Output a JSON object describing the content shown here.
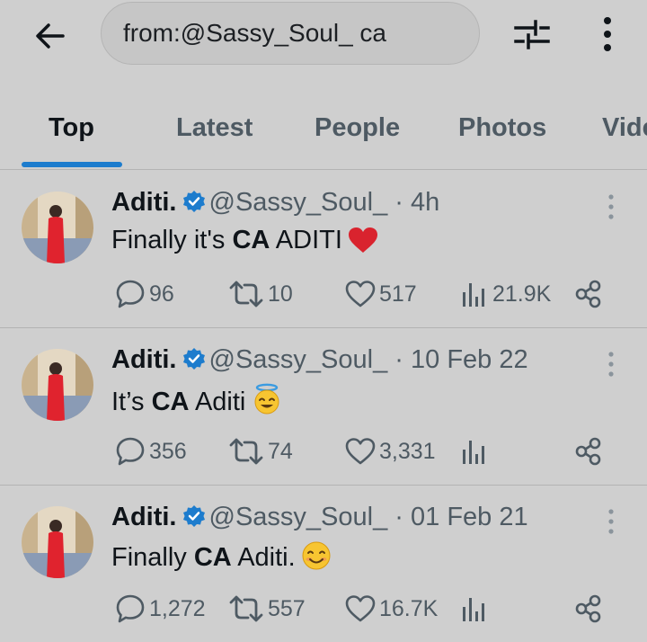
{
  "search": {
    "query": "from:@Sassy_Soul_ ca"
  },
  "tabs": [
    {
      "label": "Top",
      "active": true
    },
    {
      "label": "Latest",
      "active": false
    },
    {
      "label": "People",
      "active": false
    },
    {
      "label": "Photos",
      "active": false
    },
    {
      "label": "Videos",
      "active": false
    }
  ],
  "tweets": [
    {
      "name": "Aditi.",
      "handle": "@Sassy_Soul_",
      "dot": "·",
      "time": "4h",
      "text_before": "Finally it's ",
      "text_bold": "CA",
      "text_after": " ADITI",
      "emoji": "red-heart-icon",
      "replies": "96",
      "retweets": "10",
      "likes": "517",
      "views": "21.9K"
    },
    {
      "name": "Aditi.",
      "handle": "@Sassy_Soul_",
      "dot": "·",
      "time": "10 Feb 22",
      "text_before": "It’s ",
      "text_bold": "CA",
      "text_after": " Aditi",
      "emoji": "halo-smile-icon",
      "replies": "356",
      "retweets": "74",
      "likes": "3,331",
      "views": ""
    },
    {
      "name": "Aditi.",
      "handle": "@Sassy_Soul_",
      "dot": "·",
      "time": "01 Feb 21",
      "text_before": "Finally ",
      "text_bold": "CA",
      "text_after": " Aditi.",
      "emoji": "smiling-face-icon",
      "replies": "1,272",
      "retweets": "557",
      "likes": "16.7K",
      "views": ""
    }
  ],
  "colors": {
    "accent": "#1d7ccd",
    "verified": "#1d7ccd",
    "muted": "#4e5a63",
    "background": "#cfcfcf"
  }
}
